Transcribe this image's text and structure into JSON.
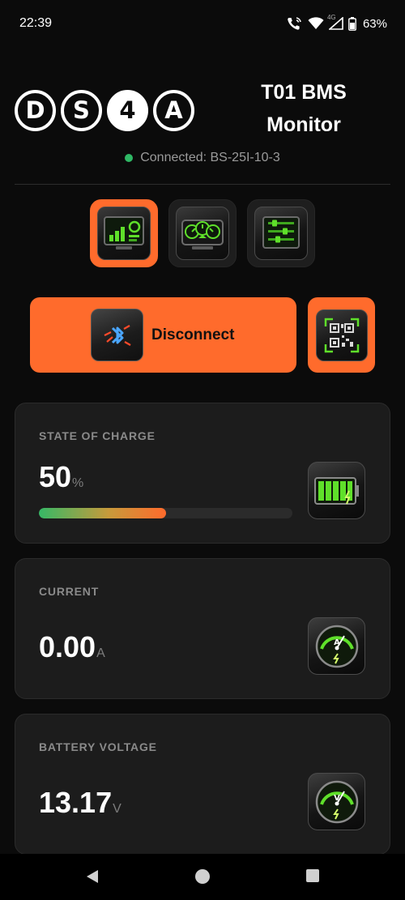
{
  "status_bar": {
    "time": "22:39",
    "network_label": "4G",
    "battery_pct": "63%"
  },
  "header": {
    "logo_letters": [
      "D",
      "S",
      "4",
      "A"
    ],
    "title_line1": "T01 BMS",
    "title_line2": "Monitor",
    "connection_status": "Connected: BS-25I-10-3"
  },
  "nav_tabs": [
    {
      "name": "dashboard",
      "icon": "dashboard-monitor-icon",
      "active": true
    },
    {
      "name": "gauges",
      "icon": "gauges-panel-icon",
      "active": false
    },
    {
      "name": "settings",
      "icon": "sliders-settings-icon",
      "active": false
    }
  ],
  "actions": {
    "disconnect_label": "Disconnect",
    "bluetooth_icon": "bluetooth-icon",
    "qr_icon": "qr-code-icon"
  },
  "metrics": {
    "soc": {
      "label": "STATE OF CHARGE",
      "value": "50",
      "unit": "%",
      "fraction": 0.5
    },
    "current": {
      "label": "CURRENT",
      "value": "0.00",
      "unit": "A"
    },
    "voltage": {
      "label": "BATTERY VOLTAGE",
      "value": "13.17",
      "unit": "V"
    }
  },
  "colors": {
    "accent": "#ff6b2c",
    "connected": "#2fb865",
    "card_bg": "#1c1c1c",
    "glow_green": "#5fe02a"
  }
}
